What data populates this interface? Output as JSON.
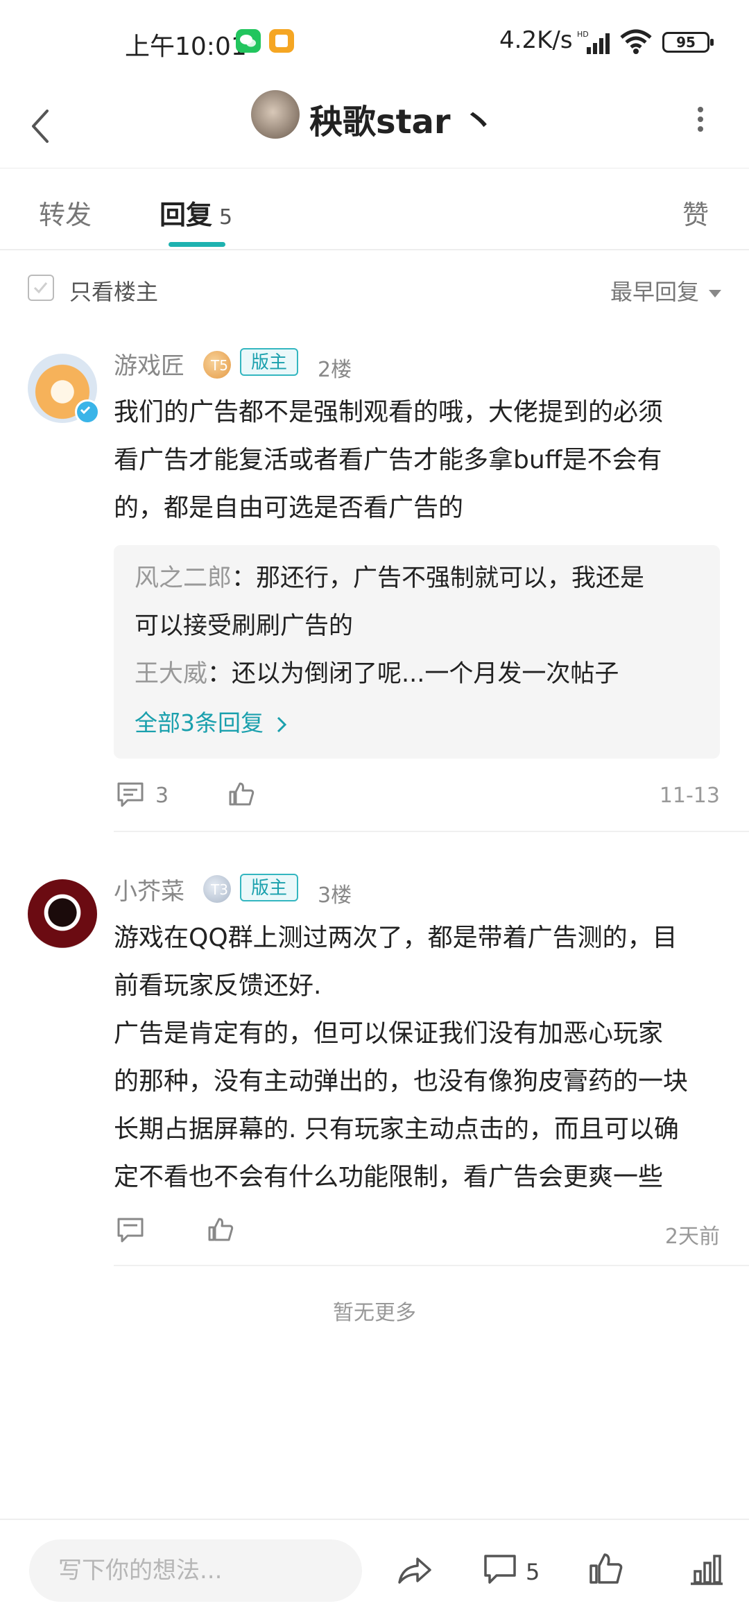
{
  "status_bar": {
    "time": "上午10:01",
    "net_speed": "4.2K/s",
    "signal_tag": "HD",
    "battery": "95",
    "wechat_color": "#22c55e",
    "note_color": "#f5a623"
  },
  "nav": {
    "title": "秧歌star 丶"
  },
  "tabs": {
    "forward": "转发",
    "reply": "回复",
    "reply_count": "5",
    "like": "赞"
  },
  "filter": {
    "only_op": "只看楼主",
    "sort": "最早回复"
  },
  "posts": [
    {
      "author": "游戏匠",
      "level_mark": "T5",
      "badge": "版主",
      "floor": "2楼",
      "lines": [
        "我们的广告都不是强制观看的哦，大佬提到的必须",
        "看广告才能复活或者看广告才能多拿buff是不会有",
        "的，都是自由可选是否看广告的"
      ],
      "replies": [
        {
          "name": "风之二郎",
          "text": "：那还行，广告不强制就可以，我还是",
          "text2": "可以接受刷刷广告的"
        },
        {
          "name": "王大威",
          "text": "：还以为倒闭了呢...一个月发一次帖子"
        }
      ],
      "all_replies": "全部3条回复",
      "comment_count": "3",
      "date": "11-13"
    },
    {
      "author": "小芥菜",
      "level_mark": "T3",
      "badge": "版主",
      "floor": "3楼",
      "lines": [
        "游戏在QQ群上测过两次了，都是带着广告测的，目",
        "前看玩家反馈还好.",
        "广告是肯定有的，但可以保证我们没有加恶心玩家",
        "的那种，没有主动弹出的，也没有像狗皮膏药的一块",
        "长期占据屏幕的. 只有玩家主动点击的，而且可以确",
        "定不看也不会有什么功能限制，看广告会更爽一些"
      ],
      "date": "2天前"
    }
  ],
  "no_more": "暂无更多",
  "bottom": {
    "input_placeholder": "写下你的想法...",
    "comment_count": "5"
  },
  "colors": {
    "accent": "#1eb2b0",
    "badge_text": "#1aa0ad"
  }
}
